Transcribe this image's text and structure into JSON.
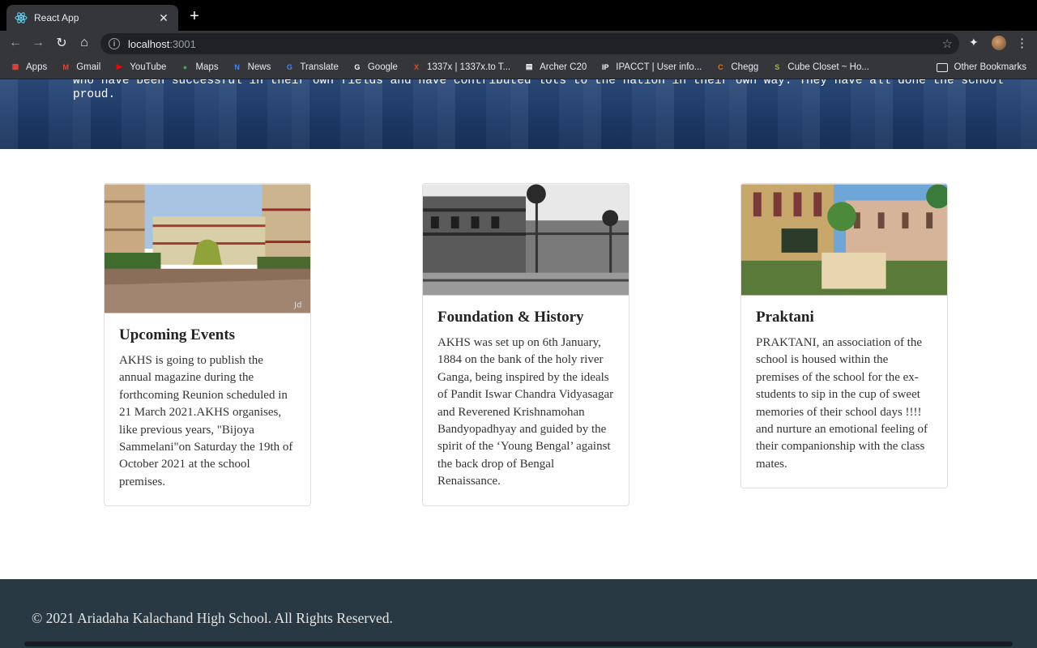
{
  "browser": {
    "tab_title": "React App",
    "url_host": "localhost",
    "url_port": ":3001",
    "bookmarks": [
      {
        "label": "Apps",
        "icon": "apps-grid-icon",
        "color": "#ea4335"
      },
      {
        "label": "Gmail",
        "icon": "gmail-icon",
        "color": "#ea4335"
      },
      {
        "label": "YouTube",
        "icon": "youtube-icon",
        "color": "#ff0000"
      },
      {
        "label": "Maps",
        "icon": "maps-pin-icon",
        "color": "#34a853"
      },
      {
        "label": "News",
        "icon": "news-icon",
        "color": "#4285f4"
      },
      {
        "label": "Translate",
        "icon": "translate-icon",
        "color": "#4285f4"
      },
      {
        "label": "Google",
        "icon": "google-icon",
        "color": "#ffffff"
      },
      {
        "label": "1337x | 1337x.to T...",
        "icon": "x-icon",
        "color": "#e84a1d"
      },
      {
        "label": "Archer C20",
        "icon": "router-icon",
        "color": "#ffffff"
      },
      {
        "label": "IPACCT | User info...",
        "icon": "ip-icon",
        "color": "#ffffff"
      },
      {
        "label": "Chegg",
        "icon": "chegg-icon",
        "color": "#eb7100"
      },
      {
        "label": "Cube Closet ~ Ho...",
        "icon": "shopify-icon",
        "color": "#95bf47"
      }
    ],
    "other_bookmarks": "Other Bookmarks"
  },
  "hero": {
    "text": "who have been successful in their own fields and have contributed lots to the nation in their own way. They have all done the school proud."
  },
  "cards": [
    {
      "title": "Upcoming Events",
      "text": "AKHS is going to publish the annual magazine during the forthcoming Reunion scheduled in 21 March 2021.AKHS organises, like previous years, \"Bijoya Sammelani\"on Saturday the 19th of October 2021 at the school premises.",
      "watermark": "Jd"
    },
    {
      "title": "Foundation & History",
      "text": "AKHS was set up on 6th January, 1884 on the bank of the holy river Ganga, being inspired by the ideals of Pandit Iswar Chandra Vidyasagar and Reverened Krishnamohan Bandyopadhyay and guided by the spirit of the ‘Young Bengal’ against the back drop of Bengal Renaissance."
    },
    {
      "title": "Praktani",
      "text": "PRAKTANI, an association of the school is housed within the premises of the school for the ex-students to sip in the cup of sweet memories of their school days !!!! and nurture an emotional feeling of their companionship with the class mates."
    }
  ],
  "footer": {
    "text": "© 2021 Ariadaha Kalachand High School. All Rights Reserved."
  }
}
